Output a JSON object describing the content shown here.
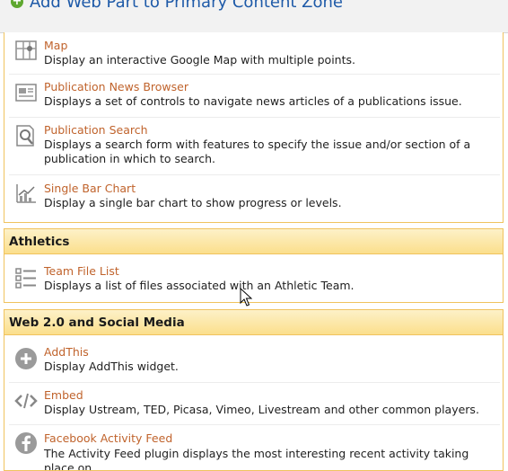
{
  "header": {
    "title": "Add Web Part to Primary Content Zone"
  },
  "top_items": [
    {
      "title": "Map",
      "desc": "Display an interactive Google Map with multiple points."
    },
    {
      "title": "Publication News Browser",
      "desc": "Displays a set of controls to navigate news articles of a publications issue."
    },
    {
      "title": "Publication Search",
      "desc": "Displays a search form with features to specify the issue and/or section of a publication in which to search."
    },
    {
      "title": "Single Bar Chart",
      "desc": "Display a single bar chart to show progress or levels."
    }
  ],
  "athletics": {
    "heading": "Athletics",
    "items": [
      {
        "title": "Team File List",
        "desc": "Displays a list of files associated with an Athletic Team."
      }
    ]
  },
  "web20": {
    "heading": "Web 2.0 and Social Media",
    "items": [
      {
        "title": "AddThis",
        "desc": "Display AddThis widget."
      },
      {
        "title": "Embed",
        "desc": "Display Ustream, TED, Picasa, Vimeo, Livestream and other common players."
      },
      {
        "title": "Facebook Activity Feed",
        "desc": "The Activity Feed plugin displays the most interesting recent activity taking place on"
      }
    ]
  }
}
